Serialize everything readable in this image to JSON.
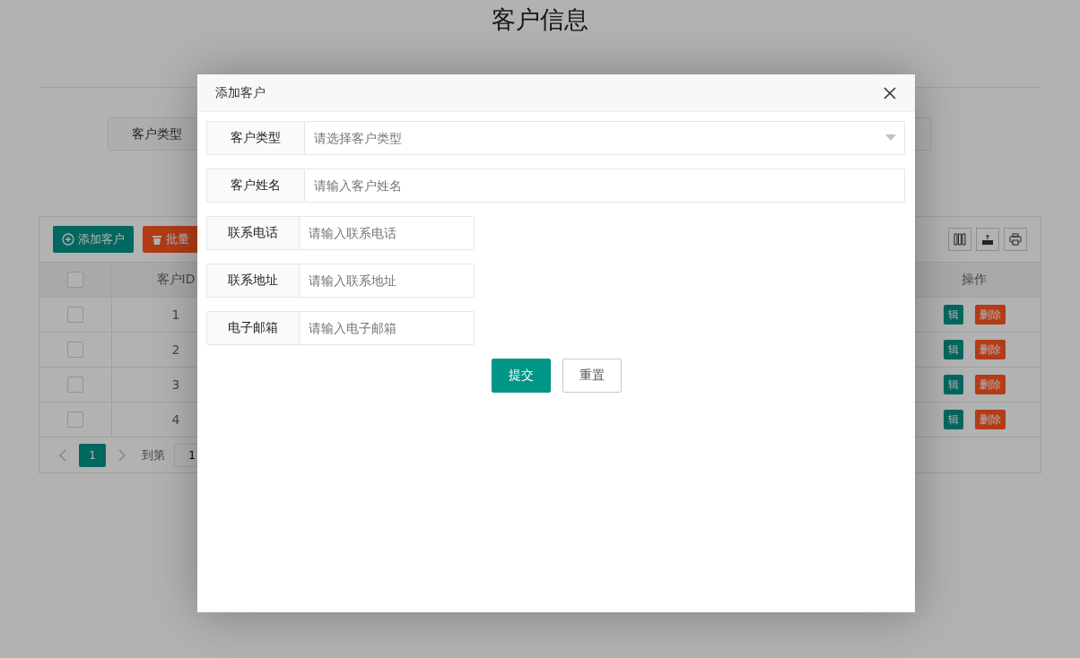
{
  "page": {
    "title": "客户信息"
  },
  "search": {
    "label": "客户类型"
  },
  "toolbar": {
    "buttons": [
      {
        "kind": "add",
        "label": "添加客户"
      },
      {
        "kind": "delete",
        "label": "批量"
      }
    ]
  },
  "table": {
    "all_checked": false,
    "columns": [
      "客户ID",
      "操作"
    ],
    "rows": [
      {
        "id": "1",
        "checked": false,
        "actions": [
          {
            "kind": "edit",
            "label": "辑"
          },
          {
            "kind": "delete",
            "label": "删除"
          }
        ]
      },
      {
        "id": "2",
        "checked": false,
        "actions": [
          {
            "kind": "edit",
            "label": "辑"
          },
          {
            "kind": "delete",
            "label": "删除"
          }
        ]
      },
      {
        "id": "3",
        "checked": false,
        "actions": [
          {
            "kind": "edit",
            "label": "辑"
          },
          {
            "kind": "delete",
            "label": "删除"
          }
        ]
      },
      {
        "id": "4",
        "checked": false,
        "actions": [
          {
            "kind": "edit",
            "label": "辑"
          },
          {
            "kind": "delete",
            "label": "删除"
          }
        ]
      }
    ]
  },
  "pagination": {
    "pages": [
      {
        "label": "1",
        "selected": true
      }
    ],
    "goto_label": "到第",
    "goto_value": "1"
  },
  "modal": {
    "title": "添加客户",
    "fields": [
      {
        "kind": "select",
        "label": "客户类型",
        "placeholder": "请选择客户类型",
        "wide": true
      },
      {
        "kind": "text",
        "label": "客户姓名",
        "placeholder": "请输入客户姓名",
        "wide": true
      },
      {
        "kind": "text",
        "label": "联系电话",
        "placeholder": "请输入联系电话",
        "wide": false
      },
      {
        "kind": "text",
        "label": "联系地址",
        "placeholder": "请输入联系地址",
        "wide": false
      },
      {
        "kind": "text",
        "label": "电子邮箱",
        "placeholder": "请输入电子邮箱",
        "wide": false
      }
    ],
    "buttons": [
      {
        "kind": "primary",
        "label": "提交"
      },
      {
        "kind": "default",
        "label": "重置"
      }
    ]
  }
}
